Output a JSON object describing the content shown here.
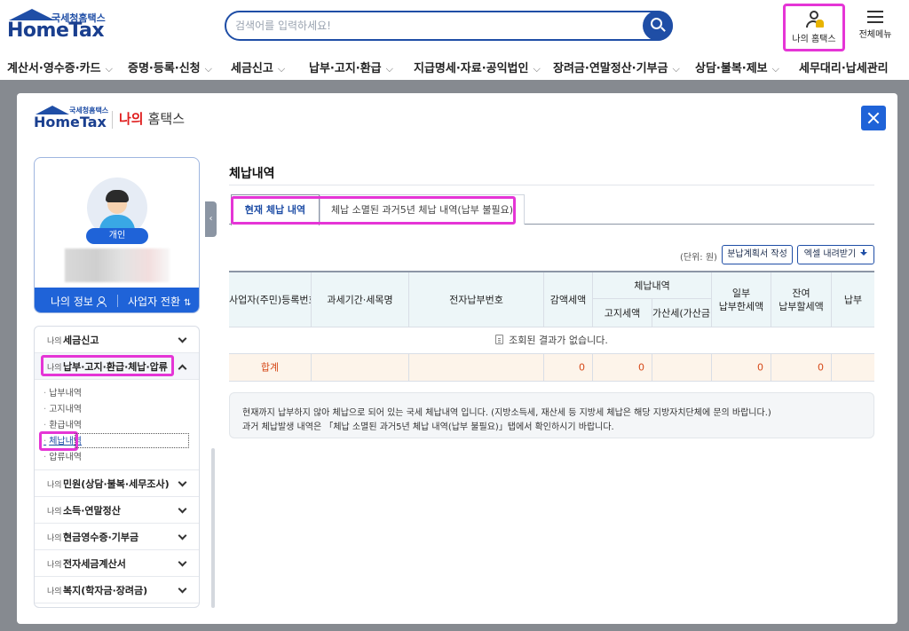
{
  "site": {
    "logo_sub": "국세청홈택스",
    "logo_main": "HomeTax",
    "search_placeholder": "검색어를 입력하세요!",
    "my_hometax_label": "나의 홈택스",
    "all_menu_label": "전체메뉴",
    "gnb": [
      {
        "label": "계산서·영수증·카드"
      },
      {
        "label": "증명·등록·신청"
      },
      {
        "label": "세금신고"
      },
      {
        "label": "납부·고지·환급"
      },
      {
        "label": "지급명세·자료·공익법인"
      },
      {
        "label": "장려금·연말정산·기부금"
      },
      {
        "label": "상담·불복·제보"
      },
      {
        "label": "세무대리·납세관리"
      }
    ]
  },
  "modal": {
    "logo_sub": "국세청홈택스",
    "logo_main": "HomeTax",
    "title_red": "나의",
    "title_rest": "홈택스",
    "profile": {
      "badge": "개인",
      "my_info": "나의 정보",
      "switch_business": "사업자 전환"
    },
    "menu": [
      {
        "prefix": "나의",
        "name": "세금신고"
      },
      {
        "prefix": "나의",
        "name": "납부·고지·환급·체납·압류"
      },
      {
        "prefix": "나의",
        "name": "민원(상담·불복·세무조사)"
      },
      {
        "prefix": "나의",
        "name": "소득·연말정산"
      },
      {
        "prefix": "나의",
        "name": "현금영수증·기부금"
      },
      {
        "prefix": "나의",
        "name": "전자세금계산서"
      },
      {
        "prefix": "나의",
        "name": "복지(학자금·장려금)"
      }
    ],
    "submenu": [
      {
        "label": "납부내역"
      },
      {
        "label": "고지내역"
      },
      {
        "label": "환급내역"
      },
      {
        "label": "체납내역"
      },
      {
        "label": "압류내역"
      }
    ],
    "content": {
      "title": "체납내역",
      "tabs": [
        {
          "label": "현재 체납 내역"
        },
        {
          "label": "체납 소멸된 과거5년 체납 내역(납부 불필요)"
        }
      ],
      "unit": "(단위: 원)",
      "btn_plan": "분납계획서 작성",
      "btn_excel": "엑셀 내려받기",
      "headers": {
        "biz_no": "사업자(주민)등록번호",
        "period": "과세기간·세목명",
        "epay_no": "전자납부번호",
        "reduced": "감액세액",
        "arrears": "체납내역",
        "notice_tax": "고지세액",
        "penalty": "가산세(가산금)",
        "partial": "일부\n납부한세액",
        "remaining": "잔여\n납부할세액",
        "pay": "납부"
      },
      "empty_msg": "조회된 결과가 없습니다.",
      "total": {
        "label": "합계",
        "reduced": "0",
        "notice_tax": "0",
        "partial": "0",
        "remaining": "0"
      },
      "notice_line1": "현재까지 납부하지 않아 체납으로 되어 있는 국세 체납내역 입니다. (지방소득세, 재산세 등 지방세 체납은 해당 지방자치단체에 문의 바랍니다.)",
      "notice_line2": "과거 체납발생 내역은 「체납 소멸된 과거5년 체납 내역(납부 불필요)」탭에서 확인하시기 바랍니다."
    }
  },
  "colors": {
    "brand": "#1f4ea6",
    "highlight": "#e535d6",
    "close_button": "#1f63d8",
    "total_text": "#d64a1a"
  }
}
